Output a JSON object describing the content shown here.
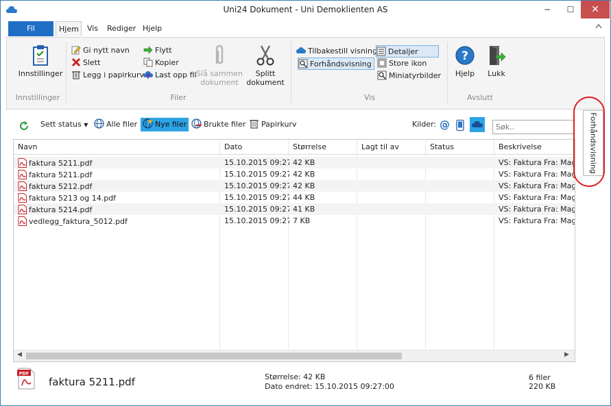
{
  "window": {
    "title": "Uni24 Dokument - Uni Demoklienten AS",
    "minimize": "─",
    "maximize": "☐",
    "close": "✕"
  },
  "menu": {
    "items": [
      "Fil",
      "Hjem",
      "Vis",
      "Rediger",
      "Hjelp"
    ],
    "collapse_icon": "chevron-up"
  },
  "ribbon": {
    "groups": {
      "innstillinger": {
        "label": "Innstillinger",
        "button": "Innstillinger"
      },
      "filer": {
        "label": "Filer",
        "rename": "Gi nytt navn",
        "delete": "Slett",
        "trash": "Legg i papirkurv",
        "move": "Flytt",
        "copy": "Kopier",
        "upload": "Last opp fil",
        "merge_line1": "Slå sammen",
        "merge_line2": "dokument",
        "split_line1": "Splitt",
        "split_line2": "dokument"
      },
      "vis": {
        "label": "Vis",
        "reset": "Tilbakestill visning",
        "preview": "Forhåndsvisning",
        "details": "Detaljer",
        "large_icons": "Store ikon",
        "thumbnails": "Miniatyrbilder"
      },
      "avslutt": {
        "label": "Avslutt",
        "help": "Hjelp",
        "close": "Lukk"
      }
    }
  },
  "toolbar": {
    "set_status": "Sett status",
    "all_files": "Alle filer",
    "new_files": "Nye filer",
    "used_files": "Brukte filer",
    "trash": "Papirkurv",
    "sources_label": "Kilder:",
    "search_placeholder": "Søk.."
  },
  "grid": {
    "columns": [
      "Navn",
      "Dato",
      "Størrelse",
      "Lagt til av",
      "Status",
      "Beskrivelse"
    ],
    "rows": [
      {
        "name": "faktura 5211.pdf",
        "date": "15.10.2015 09:27",
        "size": "42 KB",
        "added_by": "",
        "status": "",
        "desc": "VS: Faktura Fra: Magr"
      },
      {
        "name": "faktura 5211.pdf",
        "date": "15.10.2015 09:27",
        "size": "42 KB",
        "added_by": "",
        "status": "",
        "desc": "VS: Faktura Fra: Magr"
      },
      {
        "name": "faktura 5212.pdf",
        "date": "15.10.2015 09:27",
        "size": "42 KB",
        "added_by": "",
        "status": "",
        "desc": "VS: Faktura Fra: Magr"
      },
      {
        "name": "faktura 5213 og 14.pdf",
        "date": "15.10.2015 09:27",
        "size": "44 KB",
        "added_by": "",
        "status": "",
        "desc": "VS: Faktura Fra: Magr"
      },
      {
        "name": "faktura 5214.pdf",
        "date": "15.10.2015 09:27",
        "size": "41 KB",
        "added_by": "",
        "status": "",
        "desc": "VS: Faktura Fra: Magr"
      },
      {
        "name": "vedlegg_faktura_5012.pdf",
        "date": "15.10.2015 09:27",
        "size": "7 KB",
        "added_by": "",
        "status": "",
        "desc": "VS: Faktura Fra: Magr"
      }
    ]
  },
  "detail": {
    "icon_label": "PDF",
    "filename": "faktura 5211.pdf",
    "size_text": "Størrelse: 42 KB",
    "modified_text": "Dato endret: 15.10.2015 09:27:00",
    "count_text": "6 filer",
    "total_size": "220 KB"
  },
  "side_panel": {
    "label": "Forhåndsvisning"
  },
  "colors": {
    "accent": "#1f6fc5",
    "selected_filter": "#2ca3e5",
    "highlight": "#e02020",
    "pdf_red": "#c8202a"
  }
}
